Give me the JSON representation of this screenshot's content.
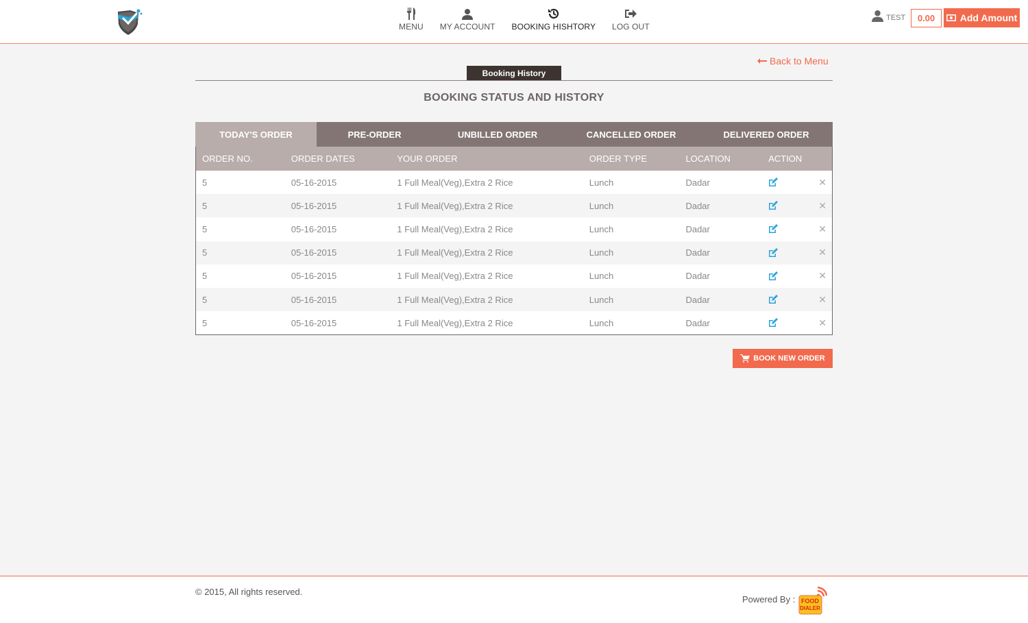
{
  "header": {
    "nav": [
      {
        "label": "MENU",
        "icon": "cutlery-icon"
      },
      {
        "label": "MY ACCOUNT",
        "icon": "user-icon"
      },
      {
        "label": "BOOKING HISHTORY",
        "icon": "history-icon"
      },
      {
        "label": "LOG OUT",
        "icon": "logout-icon"
      }
    ],
    "username": "TEST",
    "balance": "0.00",
    "add_amount_label": "Add Amount"
  },
  "main": {
    "back_link": "Back to Menu",
    "section_tag": "Booking History",
    "title": "BOOKING STATUS AND HISTORY",
    "tabs": [
      "TODAY'S ORDER",
      "PRE-ORDER",
      "UNBILLED ORDER",
      "CANCELLED ORDER",
      "DELIVERED ORDER"
    ],
    "active_tab": "TODAY'S ORDER",
    "columns": [
      "ORDER NO.",
      "ORDER DATES",
      "YOUR ORDER",
      "ORDER TYPE",
      "LOCATION",
      "ACTION"
    ],
    "rows": [
      [
        "5",
        "05-16-2015",
        "1 Full Meal(Veg),Extra 2 Rice",
        "Lunch",
        "Dadar"
      ],
      [
        "5",
        "05-16-2015",
        "1 Full Meal(Veg),Extra 2 Rice",
        "Lunch",
        "Dadar"
      ],
      [
        "5",
        "05-16-2015",
        "1 Full Meal(Veg),Extra 2 Rice",
        "Lunch",
        "Dadar"
      ],
      [
        "5",
        "05-16-2015",
        "1 Full Meal(Veg),Extra 2 Rice",
        "Lunch",
        "Dadar"
      ],
      [
        "5",
        "05-16-2015",
        "1 Full Meal(Veg),Extra 2 Rice",
        "Lunch",
        "Dadar"
      ],
      [
        "5",
        "05-16-2015",
        "1 Full Meal(Veg),Extra 2 Rice",
        "Lunch",
        "Dadar"
      ],
      [
        "5",
        "05-16-2015",
        "1 Full Meal(Veg),Extra 2 Rice",
        "Lunch",
        "Dadar"
      ]
    ],
    "book_new_order_label": "BOOK NEW ORDER"
  },
  "footer": {
    "copyright": "© 2015, All rights reserved.",
    "powered_by": "Powered By :",
    "logo_text": [
      "FOOD",
      "DIALER"
    ]
  },
  "colors": {
    "accent": "#f26a4d",
    "tab_bar": "#827574",
    "tab_active": "#b8adab",
    "section_tag": "#3d3331",
    "edit_icon": "#2aa4d8"
  }
}
